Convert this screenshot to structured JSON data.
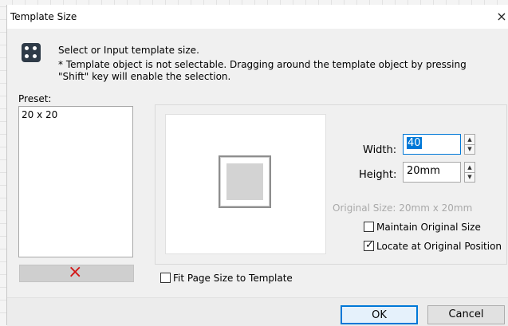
{
  "dialog": {
    "title": "Template Size",
    "close_glyph": "×",
    "message_primary": "Select or Input template size.",
    "message_secondary": "* Template object is not selectable. Dragging around the template object by pressing \"Shift\" key will enable the selection."
  },
  "preset": {
    "label": "Preset:",
    "items": [
      "20 x 20"
    ],
    "delete_icon": "×"
  },
  "size": {
    "width_label": "Width:",
    "width_value": "40",
    "height_label": "Height:",
    "height_value": "20mm",
    "original_size": "Original Size:  20mm x 20mm",
    "spin_up": "▲",
    "spin_down": "▼"
  },
  "options": {
    "maintain_label": "Maintain Original Size",
    "maintain_checked": false,
    "locate_label": "Locate at Original Position",
    "locate_checked": true,
    "fit_label": "Fit Page Size to Template",
    "fit_checked": false,
    "tick": "✓"
  },
  "buttons": {
    "ok": "OK",
    "cancel": "Cancel"
  },
  "colors": {
    "accent": "#0078d7",
    "delete": "#d31414"
  }
}
